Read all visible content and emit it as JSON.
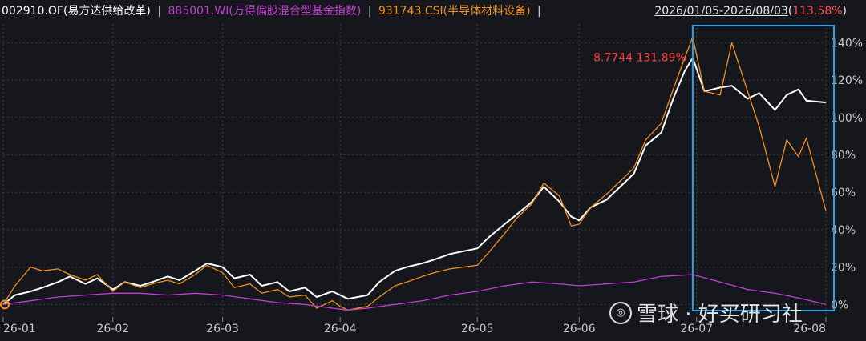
{
  "header": {
    "series_1_label": "002910.OF(易方达供给改革)",
    "series_2_label": "885001.WI(万得偏股混合型基金指数)",
    "series_3_label": "931743.CSI(半导体材料设备)",
    "separator": "|",
    "date_range": "2026/01/05-2026/08/03",
    "range_return": "113.58%"
  },
  "watermark": {
    "text": "雪球 · 好买研习社"
  },
  "chart_data": {
    "type": "line",
    "xlim": [
      "2026-01-05",
      "2026-08-03"
    ],
    "x_ticks": [
      {
        "label": "26-01",
        "date": "2026-01-05"
      },
      {
        "label": "26-02",
        "date": "2026-02-02"
      },
      {
        "label": "26-03",
        "date": "2026-03-02"
      },
      {
        "label": "26-04",
        "date": "2026-04-01"
      },
      {
        "label": "26-05",
        "date": "2026-05-06"
      },
      {
        "label": "26-06",
        "date": "2026-06-01"
      },
      {
        "label": "26-07",
        "date": "2026-07-01"
      },
      {
        "label": "26-08",
        "date": "2026-08-03"
      }
    ],
    "ylim": [
      -5,
      150
    ],
    "y_ticks": [
      0,
      20,
      40,
      60,
      80,
      100,
      120,
      140
    ],
    "y_tick_suffix": "%",
    "grid": true,
    "annotation": {
      "text": "8.7744 131.89%",
      "date": "2026-06-30",
      "y": 131.89
    },
    "highlight_range": [
      "2026-06-30",
      "2026-08-03"
    ],
    "colors": {
      "s1": "#ffffff",
      "s2": "#c03fd0",
      "s3": "#f0901e",
      "annotation": "#ff3b3b",
      "highlight": "#29a3e6",
      "grid": "#3a3c45",
      "axis_text": "#c8c8c8"
    },
    "series": [
      {
        "key": "s1",
        "name": "002910.OF(易方达供给改革)",
        "color": "#ffffff",
        "points": [
          [
            "2026-01-05",
            0
          ],
          [
            "2026-01-08",
            5
          ],
          [
            "2026-01-12",
            7
          ],
          [
            "2026-01-15",
            9
          ],
          [
            "2026-01-19",
            12
          ],
          [
            "2026-01-22",
            15
          ],
          [
            "2026-01-26",
            11
          ],
          [
            "2026-01-29",
            14
          ],
          [
            "2026-02-02",
            8
          ],
          [
            "2026-02-05",
            12
          ],
          [
            "2026-02-09",
            10
          ],
          [
            "2026-02-12",
            12
          ],
          [
            "2026-02-16",
            15
          ],
          [
            "2026-02-19",
            13
          ],
          [
            "2026-02-23",
            18
          ],
          [
            "2026-02-26",
            22
          ],
          [
            "2026-03-02",
            20
          ],
          [
            "2026-03-05",
            14
          ],
          [
            "2026-03-09",
            16
          ],
          [
            "2026-03-12",
            10
          ],
          [
            "2026-03-16",
            12
          ],
          [
            "2026-03-19",
            7
          ],
          [
            "2026-03-23",
            9
          ],
          [
            "2026-03-26",
            4
          ],
          [
            "2026-03-30",
            7
          ],
          [
            "2026-04-01",
            5
          ],
          [
            "2026-04-03",
            3
          ],
          [
            "2026-04-08",
            5
          ],
          [
            "2026-04-11",
            12
          ],
          [
            "2026-04-15",
            18
          ],
          [
            "2026-04-18",
            20
          ],
          [
            "2026-04-22",
            22
          ],
          [
            "2026-04-25",
            24
          ],
          [
            "2026-04-29",
            27
          ],
          [
            "2026-05-06",
            30
          ],
          [
            "2026-05-09",
            36
          ],
          [
            "2026-05-13",
            43
          ],
          [
            "2026-05-16",
            48
          ],
          [
            "2026-05-20",
            55
          ],
          [
            "2026-05-23",
            63
          ],
          [
            "2026-05-27",
            55
          ],
          [
            "2026-05-30",
            47
          ],
          [
            "2026-06-01",
            45
          ],
          [
            "2026-06-04",
            52
          ],
          [
            "2026-06-08",
            56
          ],
          [
            "2026-06-11",
            62
          ],
          [
            "2026-06-15",
            70
          ],
          [
            "2026-06-18",
            85
          ],
          [
            "2026-06-22",
            92
          ],
          [
            "2026-06-25",
            110
          ],
          [
            "2026-06-28",
            125
          ],
          [
            "2026-06-30",
            131.89
          ],
          [
            "2026-07-03",
            114
          ],
          [
            "2026-07-07",
            116
          ],
          [
            "2026-07-10",
            117
          ],
          [
            "2026-07-14",
            110
          ],
          [
            "2026-07-17",
            113
          ],
          [
            "2026-07-21",
            104
          ],
          [
            "2026-07-24",
            112
          ],
          [
            "2026-07-27",
            115
          ],
          [
            "2026-07-29",
            109
          ],
          [
            "2026-08-03",
            108
          ]
        ]
      },
      {
        "key": "s3",
        "name": "931743.CSI(半导体材料设备)",
        "color": "#f0901e",
        "points": [
          [
            "2026-01-05",
            0
          ],
          [
            "2026-01-08",
            10
          ],
          [
            "2026-01-12",
            20
          ],
          [
            "2026-01-15",
            18
          ],
          [
            "2026-01-19",
            19
          ],
          [
            "2026-01-22",
            16
          ],
          [
            "2026-01-26",
            13
          ],
          [
            "2026-01-29",
            16
          ],
          [
            "2026-02-02",
            7
          ],
          [
            "2026-02-05",
            12
          ],
          [
            "2026-02-09",
            9
          ],
          [
            "2026-02-12",
            11
          ],
          [
            "2026-02-16",
            13
          ],
          [
            "2026-02-19",
            11
          ],
          [
            "2026-02-23",
            16
          ],
          [
            "2026-02-26",
            21
          ],
          [
            "2026-03-02",
            17
          ],
          [
            "2026-03-05",
            9
          ],
          [
            "2026-03-09",
            11
          ],
          [
            "2026-03-12",
            6
          ],
          [
            "2026-03-16",
            8
          ],
          [
            "2026-03-19",
            4
          ],
          [
            "2026-03-23",
            5
          ],
          [
            "2026-03-26",
            -2
          ],
          [
            "2026-03-30",
            2
          ],
          [
            "2026-04-01",
            -1
          ],
          [
            "2026-04-03",
            -3
          ],
          [
            "2026-04-08",
            -1
          ],
          [
            "2026-04-11",
            4
          ],
          [
            "2026-04-15",
            10
          ],
          [
            "2026-04-18",
            12
          ],
          [
            "2026-04-22",
            15
          ],
          [
            "2026-04-25",
            17
          ],
          [
            "2026-04-29",
            19
          ],
          [
            "2026-05-06",
            21
          ],
          [
            "2026-05-09",
            28
          ],
          [
            "2026-05-13",
            38
          ],
          [
            "2026-05-16",
            46
          ],
          [
            "2026-05-20",
            54
          ],
          [
            "2026-05-23",
            65
          ],
          [
            "2026-05-27",
            58
          ],
          [
            "2026-05-30",
            42
          ],
          [
            "2026-06-01",
            43
          ],
          [
            "2026-06-04",
            52
          ],
          [
            "2026-06-08",
            59
          ],
          [
            "2026-06-11",
            65
          ],
          [
            "2026-06-15",
            73
          ],
          [
            "2026-06-18",
            88
          ],
          [
            "2026-06-22",
            97
          ],
          [
            "2026-06-25",
            115
          ],
          [
            "2026-06-28",
            132
          ],
          [
            "2026-06-30",
            143
          ],
          [
            "2026-07-03",
            114
          ],
          [
            "2026-07-07",
            112
          ],
          [
            "2026-07-10",
            140
          ],
          [
            "2026-07-14",
            114
          ],
          [
            "2026-07-17",
            95
          ],
          [
            "2026-07-21",
            63
          ],
          [
            "2026-07-24",
            88
          ],
          [
            "2026-07-27",
            79
          ],
          [
            "2026-07-29",
            89
          ],
          [
            "2026-08-03",
            50
          ]
        ]
      },
      {
        "key": "s2",
        "name": "885001.WI(万得偏股混合型基金指数)",
        "color": "#c03fd0",
        "points": [
          [
            "2026-01-05",
            0
          ],
          [
            "2026-01-12",
            2
          ],
          [
            "2026-01-19",
            4
          ],
          [
            "2026-01-26",
            5
          ],
          [
            "2026-02-02",
            6
          ],
          [
            "2026-02-09",
            6
          ],
          [
            "2026-02-16",
            5
          ],
          [
            "2026-02-23",
            6
          ],
          [
            "2026-03-02",
            5
          ],
          [
            "2026-03-09",
            3
          ],
          [
            "2026-03-16",
            1
          ],
          [
            "2026-03-23",
            0
          ],
          [
            "2026-03-30",
            -2
          ],
          [
            "2026-04-03",
            -3
          ],
          [
            "2026-04-08",
            -2
          ],
          [
            "2026-04-15",
            0
          ],
          [
            "2026-04-22",
            2
          ],
          [
            "2026-04-29",
            5
          ],
          [
            "2026-05-06",
            7
          ],
          [
            "2026-05-13",
            10
          ],
          [
            "2026-05-20",
            12
          ],
          [
            "2026-05-27",
            11
          ],
          [
            "2026-06-01",
            10
          ],
          [
            "2026-06-08",
            11
          ],
          [
            "2026-06-15",
            12
          ],
          [
            "2026-06-22",
            15
          ],
          [
            "2026-06-30",
            16
          ],
          [
            "2026-07-07",
            12
          ],
          [
            "2026-07-14",
            8
          ],
          [
            "2026-07-21",
            6
          ],
          [
            "2026-07-28",
            3
          ],
          [
            "2026-08-03",
            0
          ]
        ]
      }
    ]
  }
}
